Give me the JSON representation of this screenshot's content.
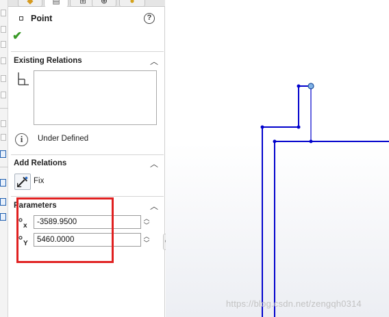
{
  "property_manager": {
    "title": "Point",
    "help_symbol": "?",
    "ok_symbol": "✔"
  },
  "tabs": [
    {
      "icon": "feature-manager-icon",
      "active": false
    },
    {
      "icon": "property-manager-icon",
      "active": true
    },
    {
      "icon": "configuration-manager-icon",
      "active": false
    },
    {
      "icon": "dimxpert-manager-icon",
      "active": false
    },
    {
      "icon": "display-manager-icon",
      "active": false
    }
  ],
  "existing_relations": {
    "header": "Existing Relations",
    "status_text": "Under Defined"
  },
  "add_relations": {
    "header": "Add Relations",
    "fix_label": "Fix"
  },
  "parameters": {
    "header": "Parameters",
    "x_value": "-3589.9500",
    "y_value": "5460.0000"
  },
  "colors": {
    "sketch_line": "#0000cc",
    "highlight": "#e02020",
    "ok_green": "#3a9a28"
  },
  "watermark": "https://blog.csdn.net/zengqh0314"
}
